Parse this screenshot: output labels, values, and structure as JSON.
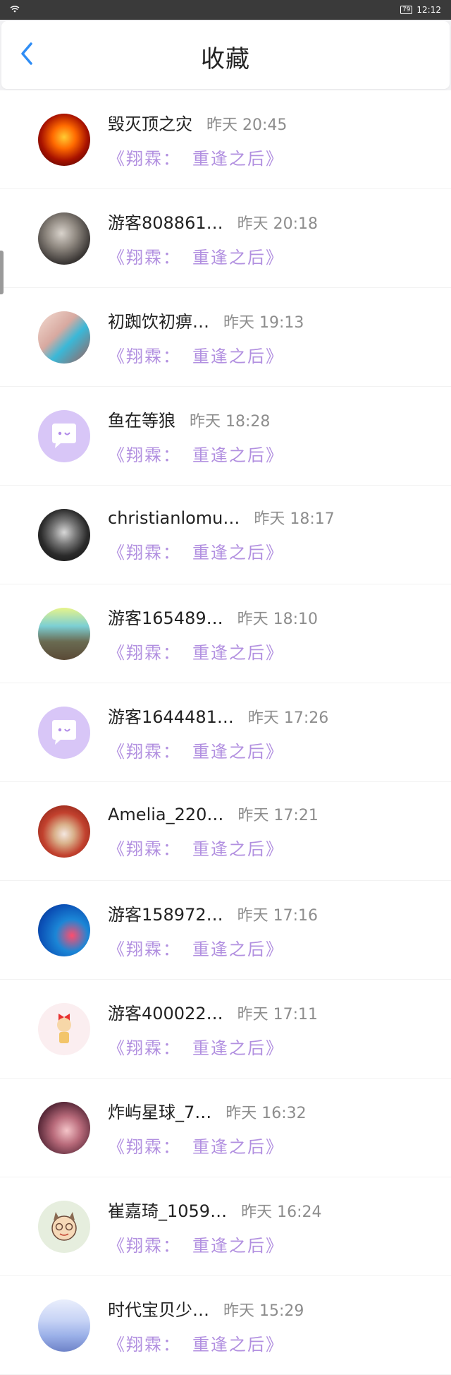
{
  "status": {
    "time": "12:12",
    "battery": "79"
  },
  "header": {
    "title": "收藏"
  },
  "items": [
    {
      "name": "毁灭顶之灾",
      "time": "昨天 20:45",
      "work": "《翔霖：",
      "work2": "重逢之后》",
      "avatar": "fire"
    },
    {
      "name": "游客808861…",
      "time": "昨天 20:18",
      "work": "《翔霖：",
      "work2": "重逢之后》",
      "avatar": "man"
    },
    {
      "name": "初踟饮初痹…",
      "time": "昨天 19:13",
      "work": "《翔霖：",
      "work2": "重逢之后》",
      "avatar": "bottle"
    },
    {
      "name": "鱼在等狼",
      "time": "昨天 18:28",
      "work": "《翔霖：",
      "work2": "重逢之后》",
      "avatar": "default"
    },
    {
      "name": "christianlomu…",
      "time": "昨天 18:17",
      "work": "《翔霖：",
      "work2": "重逢之后》",
      "avatar": "dark"
    },
    {
      "name": "游客165489…",
      "time": "昨天 18:10",
      "work": "《翔霖：",
      "work2": "重逢之后》",
      "avatar": "field"
    },
    {
      "name": "游客1644481…",
      "time": "昨天 17:26",
      "work": "《翔霖：",
      "work2": "重逢之后》",
      "avatar": "default"
    },
    {
      "name": "Amelia_220…",
      "time": "昨天 17:21",
      "work": "《翔霖：",
      "work2": "重逢之后》",
      "avatar": "red"
    },
    {
      "name": "游客158972…",
      "time": "昨天 17:16",
      "work": "《翔霖：",
      "work2": "重逢之后》",
      "avatar": "ocean"
    },
    {
      "name": "游客400022…",
      "time": "昨天 17:11",
      "work": "《翔霖：",
      "work2": "重逢之后》",
      "avatar": "girl"
    },
    {
      "name": "炸屿星球_7…",
      "time": "昨天 16:32",
      "work": "《翔霖：",
      "work2": "重逢之后》",
      "avatar": "pink"
    },
    {
      "name": "崔嘉琦_1059…",
      "time": "昨天 16:24",
      "work": "《翔霖：",
      "work2": "重逢之后》",
      "avatar": "cartoon"
    },
    {
      "name": "时代宝贝少…",
      "time": "昨天 15:29",
      "work": "《翔霖：",
      "work2": "重逢之后》",
      "avatar": "group"
    }
  ],
  "colors": {
    "accent": "#2f8df5",
    "link": "#b290e0",
    "default_avatar": "#d8c6f7"
  }
}
